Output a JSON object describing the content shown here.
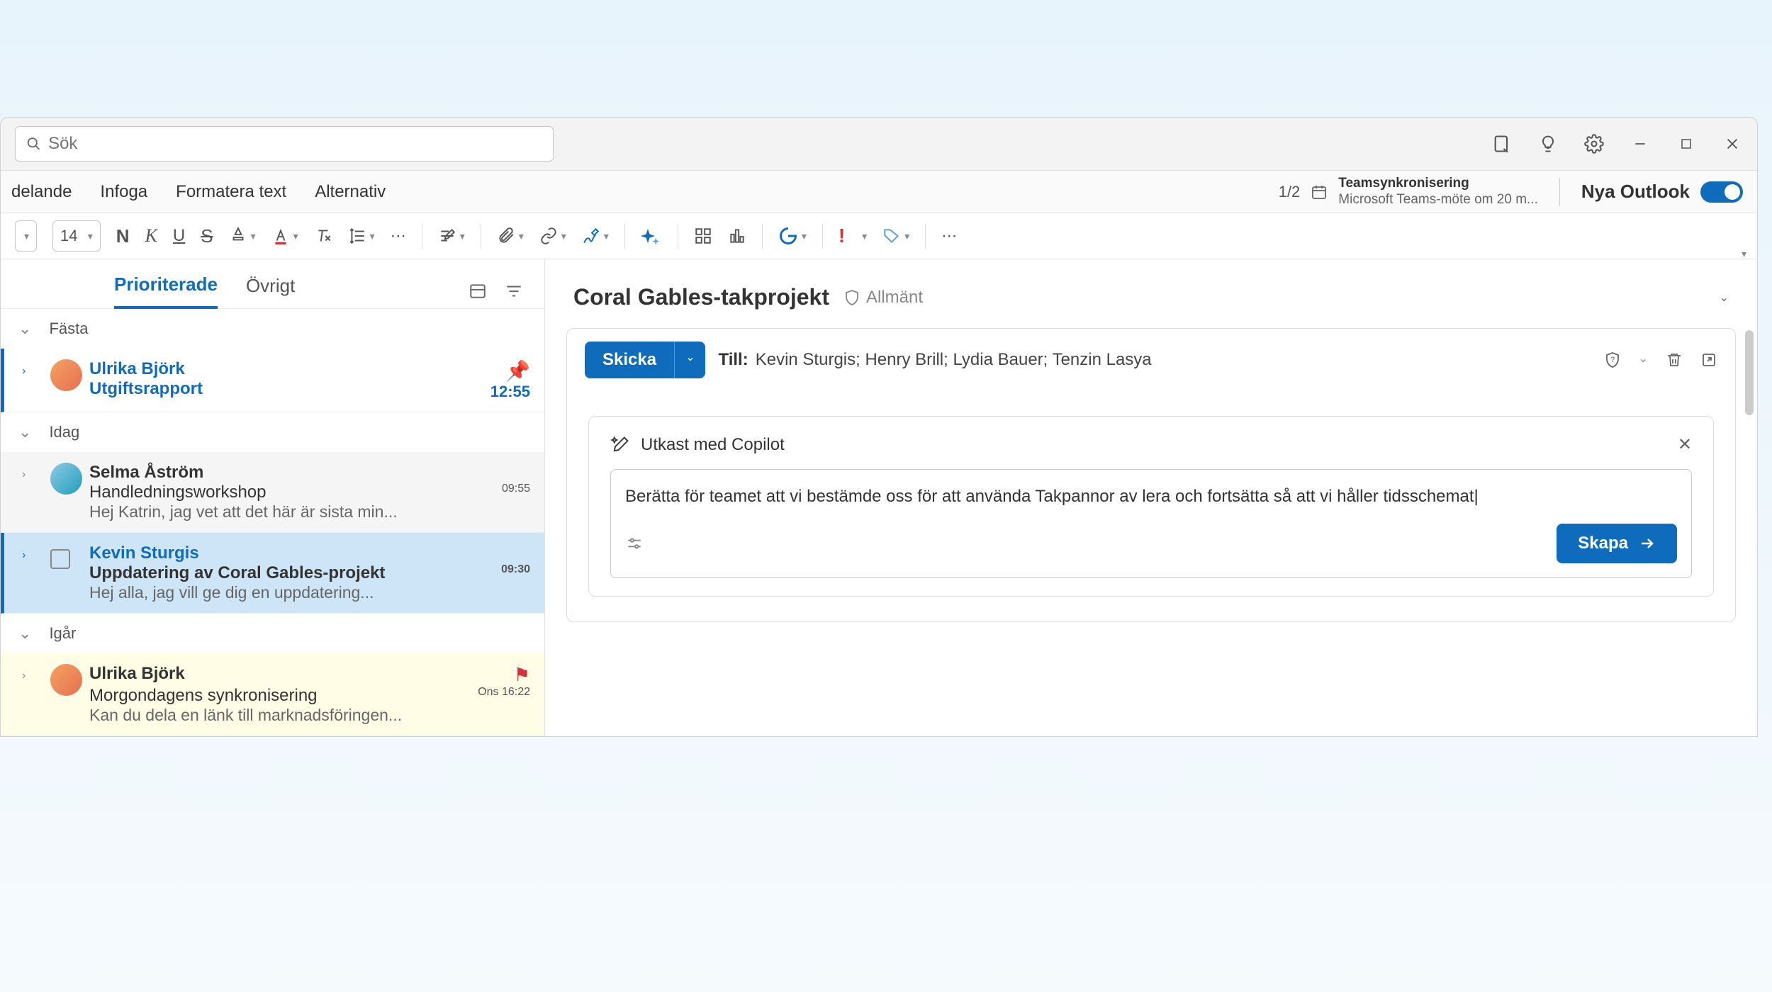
{
  "search": {
    "placeholder": "Sök"
  },
  "tabs": {
    "partial": "delande",
    "insert": "Infoga",
    "format": "Formatera text",
    "options": "Alternativ"
  },
  "pageIndicator": "1/2",
  "reminder": {
    "title": "Teamsynkronisering",
    "subtitle": "Microsoft Teams-möte om 20 m..."
  },
  "outlookToggle": "Nya Outlook",
  "fontSize": "14",
  "listTabs": {
    "focused": "Prioriterade",
    "other": "Övrigt"
  },
  "sections": {
    "pinned": "Fästa",
    "today": "Idag",
    "yesterday": "Igår"
  },
  "emails": {
    "e1": {
      "sender": "Ulrika Björk",
      "subject": "Utgiftsrapport",
      "time": "12:55"
    },
    "e2": {
      "sender": "Selma Åström",
      "subject": "Handledningsworkshop",
      "preview": "Hej Katrin, jag vet att det här är sista min...",
      "time": "09:55"
    },
    "e3": {
      "sender": "Kevin Sturgis",
      "subject": "Uppdatering av Coral Gables-projekt",
      "preview": "Hej alla, jag vill ge dig en uppdatering...",
      "time": "09:30"
    },
    "e4": {
      "sender": "Ulrika Björk",
      "subject": "Morgondagens synkronisering",
      "preview": "Kan du dela en länk till marknadsföringen...",
      "time": "Ons 16:22"
    }
  },
  "thread": {
    "title": "Coral Gables-takprojekt",
    "tag": "Allmänt"
  },
  "compose": {
    "send": "Skicka",
    "toLabel": "Till:",
    "recipients": "Kevin Sturgis; Henry Brill; Lydia Bauer; Tenzin Lasya"
  },
  "copilot": {
    "title": "Utkast med Copilot",
    "prompt": "Berätta för teamet att vi bestämde oss för att använda Takpannor av lera och fortsätta så att vi håller tidsschemat",
    "create": "Skapa"
  }
}
